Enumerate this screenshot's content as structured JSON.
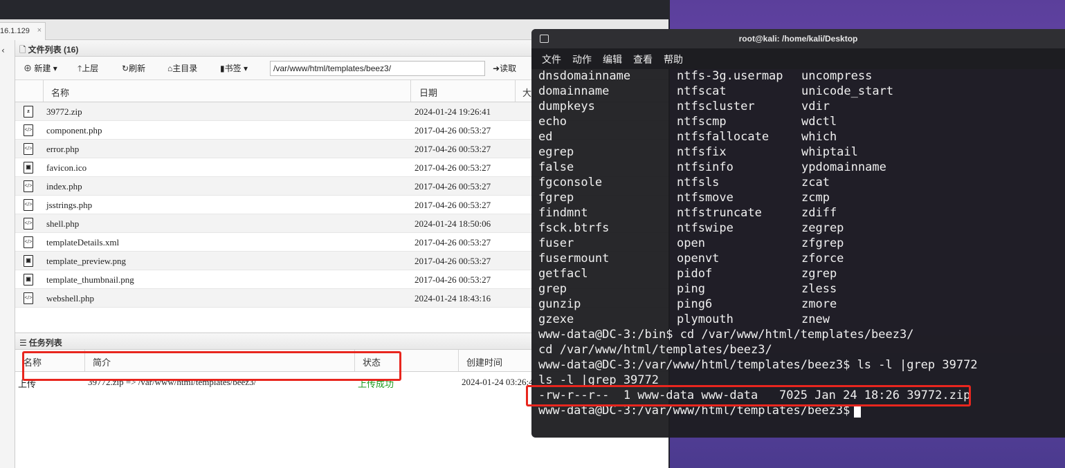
{
  "ant": {
    "tab_label": "16.1.129",
    "tab_close": "×",
    "file_panel_title": "文件列表 (16)",
    "toolbar": {
      "new": "新建",
      "up": "上层",
      "refresh": "刷新",
      "home": "主目录",
      "bookmark": "书签",
      "path": "/var/www/html/templates/beez3/",
      "read": "读取"
    },
    "columns": {
      "name": "名称",
      "date": "日期",
      "size": "大"
    },
    "files": [
      {
        "name": "39772.zip",
        "date": "2024-01-24 19:26:41",
        "icon": "zip-file-icon"
      },
      {
        "name": "component.php",
        "date": "2017-04-26 00:53:27",
        "icon": "code-file-icon"
      },
      {
        "name": "error.php",
        "date": "2017-04-26 00:53:27",
        "icon": "code-file-icon"
      },
      {
        "name": "favicon.ico",
        "date": "2017-04-26 00:53:27",
        "icon": "image-file-icon"
      },
      {
        "name": "index.php",
        "date": "2017-04-26 00:53:27",
        "icon": "code-file-icon"
      },
      {
        "name": "jsstrings.php",
        "date": "2017-04-26 00:53:27",
        "icon": "code-file-icon"
      },
      {
        "name": "shell.php",
        "date": "2024-01-24 18:50:06",
        "icon": "code-file-icon"
      },
      {
        "name": "templateDetails.xml",
        "date": "2017-04-26 00:53:27",
        "icon": "code-file-icon"
      },
      {
        "name": "template_preview.png",
        "date": "2017-04-26 00:53:27",
        "icon": "image-file-icon"
      },
      {
        "name": "template_thumbnail.png",
        "date": "2017-04-26 00:53:27",
        "icon": "image-file-icon"
      },
      {
        "name": "webshell.php",
        "date": "2024-01-24 18:43:16",
        "icon": "code-file-icon"
      }
    ],
    "task_panel_title": "任务列表",
    "task_columns": {
      "name": "名称",
      "desc": "简介",
      "status": "状态",
      "created": "创建时间"
    },
    "task": {
      "name": "上传",
      "desc": "39772.zip => /var/www/html/templates/beez3/",
      "status": "上传成功",
      "created": "2024-01-24 03:26:4"
    }
  },
  "terminal": {
    "title": "root@kali: /home/kali/Desktop",
    "menu": [
      "文件",
      "动作",
      "编辑",
      "查看",
      "帮助"
    ],
    "listing": [
      [
        "dnsdomainname",
        "ntfs-3g.usermap",
        "uncompress"
      ],
      [
        "domainname",
        "ntfscat",
        "unicode_start"
      ],
      [
        "dumpkeys",
        "ntfscluster",
        "vdir"
      ],
      [
        "echo",
        "ntfscmp",
        "wdctl"
      ],
      [
        "ed",
        "ntfsfallocate",
        "which"
      ],
      [
        "egrep",
        "ntfsfix",
        "whiptail"
      ],
      [
        "false",
        "ntfsinfo",
        "ypdomainname"
      ],
      [
        "fgconsole",
        "ntfsls",
        "zcat"
      ],
      [
        "fgrep",
        "ntfsmove",
        "zcmp"
      ],
      [
        "findmnt",
        "ntfstruncate",
        "zdiff"
      ],
      [
        "fsck.btrfs",
        "ntfswipe",
        "zegrep"
      ],
      [
        "fuser",
        "open",
        "zfgrep"
      ],
      [
        "fusermount",
        "openvt",
        "zforce"
      ],
      [
        "getfacl",
        "pidof",
        "zgrep"
      ],
      [
        "grep",
        "ping",
        "zless"
      ],
      [
        "gunzip",
        "ping6",
        "zmore"
      ],
      [
        "gzexe",
        "plymouth",
        "znew"
      ]
    ],
    "lines": [
      "www-data@DC-3:/bin$ cd /var/www/html/templates/beez3/",
      "cd /var/www/html/templates/beez3/",
      "www-data@DC-3:/var/www/html/templates/beez3$ ls -l |grep 39772",
      "ls -l |grep 39772",
      "-rw-r--r--  1 www-data www-data   7025 Jan 24 18:26 39772.zip",
      "www-data@DC-3:/var/www/html/templates/beez3$"
    ]
  },
  "colors": {
    "highlight": "#e8261e",
    "success": "#1a9a1a"
  }
}
